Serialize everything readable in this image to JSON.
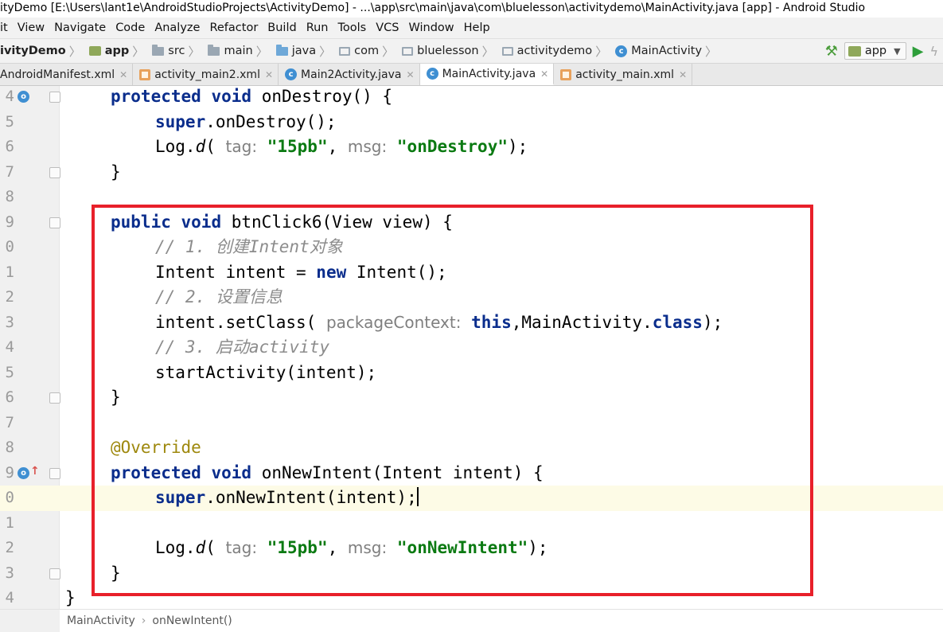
{
  "window": {
    "title": "ityDemo [E:\\Users\\lant1e\\AndroidStudioProjects\\ActivityDemo] - ...\\app\\src\\main\\java\\com\\bluelesson\\activitydemo\\MainActivity.java [app] - Android Studio"
  },
  "menu": [
    "it",
    "View",
    "Navigate",
    "Code",
    "Analyze",
    "Refactor",
    "Build",
    "Run",
    "Tools",
    "VCS",
    "Window",
    "Help"
  ],
  "breadcrumbs": [
    {
      "label": "ivityDemo",
      "icon": "project-icon"
    },
    {
      "label": "app",
      "icon": "module-icon"
    },
    {
      "label": "src",
      "icon": "folder-icon"
    },
    {
      "label": "main",
      "icon": "folder-icon"
    },
    {
      "label": "java",
      "icon": "source-folder-icon"
    },
    {
      "label": "com",
      "icon": "package-icon"
    },
    {
      "label": "bluelesson",
      "icon": "package-icon"
    },
    {
      "label": "activitydemo",
      "icon": "package-icon"
    },
    {
      "label": "MainActivity",
      "icon": "class-icon"
    }
  ],
  "toolbar": {
    "run_config": "app",
    "colors": {
      "run": "#2e9e3a",
      "build": "#4a9c3a"
    }
  },
  "tabs": [
    {
      "label": "AndroidManifest.xml",
      "icon": "manifest-icon",
      "active": false
    },
    {
      "label": "activity_main2.xml",
      "icon": "layout-xml-icon",
      "active": false
    },
    {
      "label": "Main2Activity.java",
      "icon": "class-icon",
      "active": false
    },
    {
      "label": "MainActivity.java",
      "icon": "class-icon",
      "active": true
    },
    {
      "label": "activity_main.xml",
      "icon": "layout-xml-icon",
      "active": false
    }
  ],
  "editor": {
    "line_numbers": [
      "4",
      "5",
      "6",
      "7",
      "8",
      "9",
      "0",
      "1",
      "2",
      "3",
      "4",
      "5",
      "6",
      "7",
      "8",
      "9",
      "0",
      "1",
      "2",
      "3",
      "4"
    ],
    "tokens": {
      "l0": [
        "protected",
        "void",
        "onDestroy() {"
      ],
      "l1": [
        "super",
        ".onDestroy();"
      ],
      "l2": [
        "Log.",
        "d",
        "(",
        "tag:",
        "\"15pb\"",
        ",",
        "msg:",
        "\"onDestroy\"",
        ");"
      ],
      "l3": [
        "}"
      ],
      "l5": [
        "public",
        "void",
        "btnClick6(View view) {"
      ],
      "l6": [
        "// 1. 创建Intent对象"
      ],
      "l7": [
        "Intent intent = ",
        "new",
        " Intent();"
      ],
      "l8": [
        "// 2. 设置信息"
      ],
      "l9": [
        "intent.setClass(",
        "packageContext:",
        "this",
        ",MainActivity.",
        "class",
        ");"
      ],
      "l10": [
        "// 3. 启动activity"
      ],
      "l11": [
        "startActivity(intent);"
      ],
      "l12": [
        "}"
      ],
      "l14": [
        "@Override"
      ],
      "l15": [
        "protected",
        "void",
        "onNewIntent(Intent intent) {"
      ],
      "l16": [
        "super",
        ".onNewIntent(intent);"
      ],
      "l18": [
        "Log.",
        "d",
        "(",
        "tag:",
        "\"15pb\"",
        ",",
        "msg:",
        "\"onNewIntent\"",
        ");"
      ],
      "l19": [
        "}"
      ],
      "l20": [
        "}"
      ]
    },
    "highlight_color": "#e8202a"
  },
  "footer": {
    "items": [
      "MainActivity",
      "onNewIntent()"
    ]
  }
}
